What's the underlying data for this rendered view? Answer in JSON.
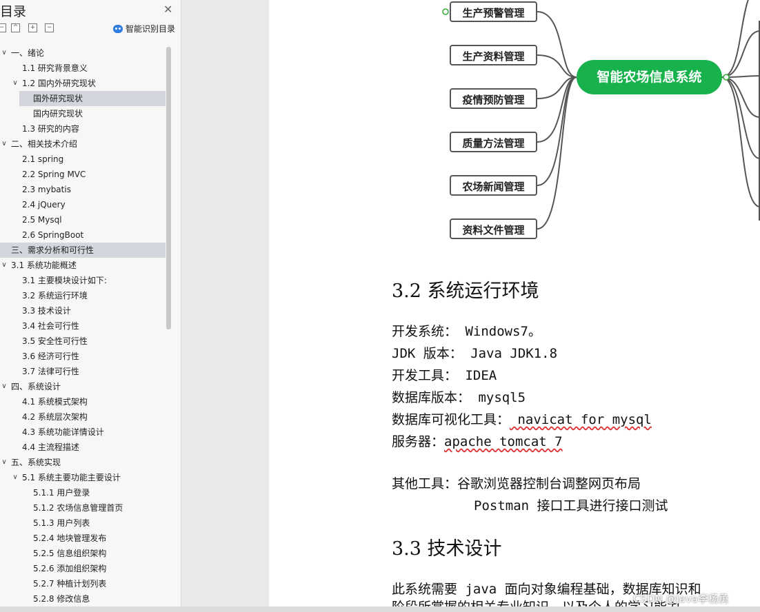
{
  "sidebar": {
    "title": "目录",
    "smart_toc": "智能识别目录",
    "toolbar": [
      "−",
      "+",
      "−"
    ],
    "toc": [
      {
        "label": "一、绪论",
        "level": 0,
        "toggle": "open"
      },
      {
        "label": "1.1 研究背景意义",
        "level": 1
      },
      {
        "label": "1.2 国内外研究现状",
        "level": 1,
        "toggle": "open"
      },
      {
        "label": "国外研究现状",
        "level": 2,
        "selected": true
      },
      {
        "label": "国内研究现状",
        "level": 2
      },
      {
        "label": "1.3 研究的内容",
        "level": 1
      },
      {
        "label": "二、相关技术介绍",
        "level": 0,
        "toggle": "open"
      },
      {
        "label": "2.1 spring",
        "level": 1
      },
      {
        "label": "2.2 Spring MVC",
        "level": 1
      },
      {
        "label": "2.3 mybatis",
        "level": 1
      },
      {
        "label": "2.4 jQuery",
        "level": 1
      },
      {
        "label": "2.5 Mysql",
        "level": 1
      },
      {
        "label": "2.6 SpringBoot",
        "level": 1
      },
      {
        "label": "三、需求分析和可行性",
        "level": 0,
        "selected": true
      },
      {
        "label": "3.1 系统功能概述",
        "level": 0,
        "toggle": "open"
      },
      {
        "label": "3.1 主要模块设计如下:",
        "level": 1
      },
      {
        "label": "3.2 系统运行环境",
        "level": 1
      },
      {
        "label": "3.3 技术设计",
        "level": 1
      },
      {
        "label": "3.4 社会可行性",
        "level": 1
      },
      {
        "label": "3.5 安全性可行性",
        "level": 1
      },
      {
        "label": "3.6 经济可行性",
        "level": 1
      },
      {
        "label": "3.7 法律可行性",
        "level": 1
      },
      {
        "label": "四、系统设计",
        "level": 0,
        "toggle": "open"
      },
      {
        "label": "4.1 系统模式架构",
        "level": 1
      },
      {
        "label": "4.2 系统层次架构",
        "level": 1
      },
      {
        "label": "4.3 系统功能详情设计",
        "level": 1
      },
      {
        "label": "4.4 主流程描述",
        "level": 1
      },
      {
        "label": "五、系统实现",
        "level": 0,
        "toggle": "open"
      },
      {
        "label": "5.1 系统主要功能主要设计",
        "level": 1,
        "toggle": "open"
      },
      {
        "label": "5.1.1 用户登录",
        "level": 2
      },
      {
        "label": "5.1.2 农场信息管理首页",
        "level": 2
      },
      {
        "label": "5.1.3 用户列表",
        "level": 2
      },
      {
        "label": "5.2.4 地块管理发布",
        "level": 2
      },
      {
        "label": "5.2.5 信息组织架构",
        "level": 2
      },
      {
        "label": "5.2.6 添加组织架构",
        "level": 2
      },
      {
        "label": "5.2.7 种植计划列表",
        "level": 2
      },
      {
        "label": "5.2.8 修改信息",
        "level": 2
      }
    ]
  },
  "mindmap": {
    "center": "智能农场信息系统",
    "left_nodes": [
      "生产预警管理",
      "生产资料管理",
      "疫情预防管理",
      "质量方法管理",
      "农场新闻管理",
      "资料文件管理"
    ],
    "center_color": "#17b24b"
  },
  "doc": {
    "h32": "3.2 系统运行环境",
    "env": [
      {
        "label": "开发系统：",
        "value": " Windows7。"
      },
      {
        "label": "JDK 版本：",
        "value": "  Java JDK1.8"
      },
      {
        "label": "开发工具：",
        "value": "  IDEA"
      },
      {
        "label": "数据库版本：",
        "value": " mysql5"
      },
      {
        "label": "数据库可视化工具：",
        "value": " navicat  for mysql"
      },
      {
        "label": "服务器：",
        "value": "apache tomcat 7"
      }
    ],
    "other1": "其他工具：谷歌浏览器控制台调整网页布局",
    "other2": "Postman 接口工具进行接口测试",
    "h33": "3.3 技术设计",
    "para1": "此系统需要 java 面向对象编程基础，数据库知识和",
    "para2": "阶段所掌握的相关专业知识，以及个人的学习能力"
  },
  "watermark": "CSDN @java李杨勇"
}
